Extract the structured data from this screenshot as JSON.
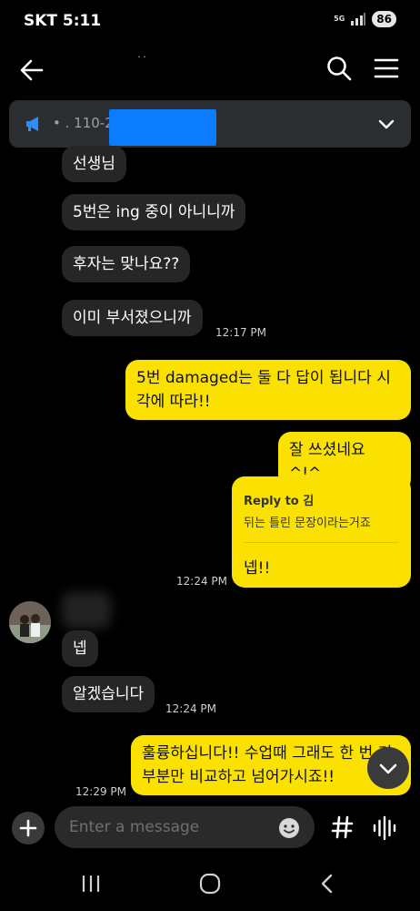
{
  "status_bar": {
    "carrier_time": "SKT 5:11",
    "network": "5G",
    "battery": "86"
  },
  "header": {
    "title": "˙˙"
  },
  "notice": {
    "text": "•  .  110-2••• 2009 •"
  },
  "messages": [
    {
      "text": "선생님"
    },
    {
      "text": "5번은 ing 중이 아니니까"
    },
    {
      "text": "후자는 맞나요??"
    },
    {
      "text": "이미 부서졌으니까",
      "time": "12:17 PM"
    },
    {
      "text": "5번 damaged는 둘 다 답이 됩니다 시각에 따라!!"
    },
    {
      "text": "잘 쓰셨네요 ^!^"
    },
    {
      "reply_label": "Reply to 김",
      "reply_quote": "뒤는 틀린 문장이라는거죠",
      "text": "넵!!",
      "time": "12:24 PM"
    },
    {
      "text": "넵"
    },
    {
      "text": "알겠습니다",
      "time": "12:24 PM"
    },
    {
      "text": "훌륭하십니다!! 수업때 그래도 한 번 기 부분만 비교하고 넘어가시죠!!",
      "time": "12:29 PM"
    }
  ],
  "input": {
    "placeholder": "Enter a message"
  },
  "icons": {
    "back": "arrow-left-icon",
    "search": "search-icon",
    "menu": "hamburger-menu-icon",
    "notice": "megaphone-icon",
    "expand": "chevron-down-icon",
    "scroll_down": "chevron-down-icon",
    "plus": "plus-icon",
    "emoji": "emoji-icon",
    "hash": "hash-icon",
    "voice": "voice-wave-icon",
    "nav_recent": "recent-apps-icon",
    "nav_home": "home-icon",
    "nav_back": "nav-back-icon"
  },
  "colors": {
    "background": "#000000",
    "incoming_bubble": "#262626",
    "outgoing_bubble": "#fae100",
    "timestamp": "#cfcfcf",
    "notice_bg": "#2b2e31"
  }
}
